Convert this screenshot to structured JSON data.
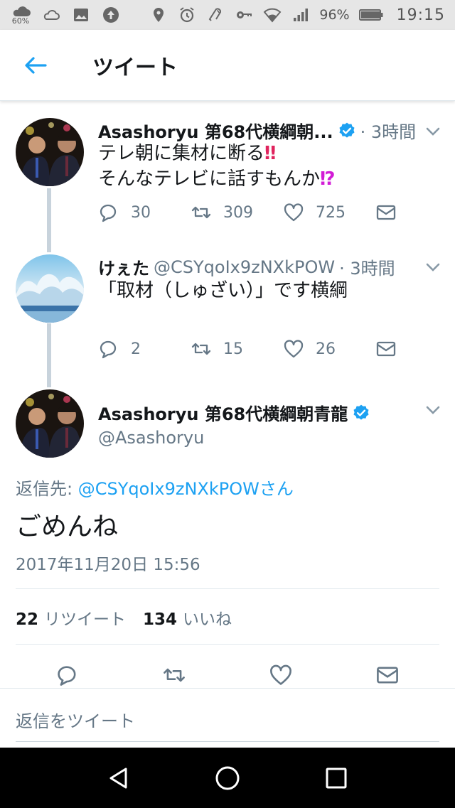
{
  "status_bar": {
    "weather_percent": "60%",
    "battery_percent": "96%",
    "time": "19:15"
  },
  "app_bar": {
    "title": "ツイート"
  },
  "thread": [
    {
      "name": "Asashoryu 第68代横綱朝...",
      "verified": true,
      "time": "· 3時間",
      "text_line1": "テレ朝に集材に断る",
      "text_line1_emoji": "‼",
      "text_line2": "そんなテレビに話すもんか",
      "text_line2_emoji": "⁉",
      "replies": "30",
      "retweets": "309",
      "likes": "725"
    },
    {
      "name": "けぇた",
      "handle": "@CSYqoIx9zNXkPOW",
      "time": "· 3時間",
      "text": "「取材（しゅざい）」です横綱",
      "replies": "2",
      "retweets": "15",
      "likes": "26"
    }
  ],
  "detail": {
    "name": "Asashoryu 第68代横綱朝青龍",
    "handle": "@Asashoryu",
    "reply_to_label": "返信先: ",
    "reply_to_mention": "@CSYqoIx9zNXkPOWさん",
    "text": "ごめんね",
    "timestamp": "2017年11月20日 15:56",
    "retweet_count": "22",
    "retweet_label": "リツイート",
    "like_count": "134",
    "like_label": "いいね"
  },
  "reply_box": {
    "placeholder": "返信をツイート"
  },
  "colors": {
    "accent": "#1da1f2",
    "text_secondary": "#657786",
    "thread_line": "#c8d3dc"
  },
  "icons": [
    "back-arrow-icon",
    "verified-badge-icon",
    "chevron-down-icon",
    "reply-icon",
    "retweet-icon",
    "like-icon",
    "dm-icon",
    "nav-back-icon",
    "nav-home-icon",
    "nav-recents-icon"
  ]
}
